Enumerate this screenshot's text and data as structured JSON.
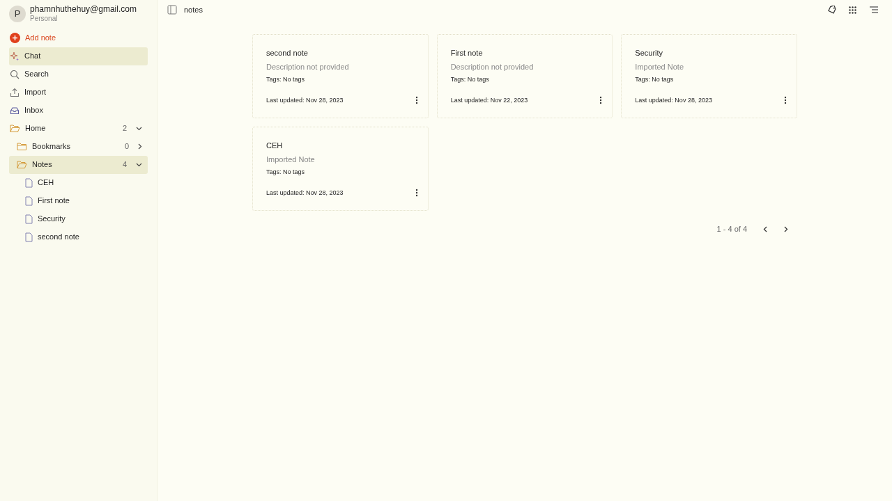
{
  "account": {
    "initial": "P",
    "email": "phamnhuthehuy@gmail.com",
    "workspace": "Personal"
  },
  "nav": [
    {
      "kind": "add",
      "label": "Add note",
      "selected": false
    },
    {
      "kind": "chat",
      "label": "Chat",
      "selected": true
    },
    {
      "kind": "search",
      "label": "Search",
      "selected": false
    },
    {
      "kind": "import",
      "label": "Import",
      "selected": false
    },
    {
      "kind": "inbox",
      "label": "Inbox",
      "selected": false
    }
  ],
  "tree": [
    {
      "kind": "folder",
      "label": "Home",
      "count": "2",
      "expanded": true,
      "selected": false,
      "children": [
        {
          "kind": "folder",
          "label": "Bookmarks",
          "count": "0",
          "expanded": false,
          "selected": false
        },
        {
          "kind": "folder",
          "label": "Notes",
          "count": "4",
          "expanded": true,
          "selected": true,
          "children": [
            {
              "kind": "note",
              "label": "CEH",
              "selected": false
            },
            {
              "kind": "note",
              "label": "First note",
              "selected": false
            },
            {
              "kind": "note",
              "label": "Security",
              "selected": false
            },
            {
              "kind": "note",
              "label": "second note",
              "selected": false
            }
          ]
        }
      ]
    }
  ],
  "header": {
    "breadcrumb": "notes"
  },
  "cards": [
    {
      "title": "second note",
      "description": "Description not provided",
      "tags": "Tags: No tags",
      "updated": "Last updated: Nov 28, 2023"
    },
    {
      "title": "First note",
      "description": "Description not provided",
      "tags": "Tags: No tags",
      "updated": "Last updated: Nov 22, 2023"
    },
    {
      "title": "Security",
      "description": "Imported Note",
      "tags": "Tags: No tags",
      "updated": "Last updated: Nov 28, 2023"
    },
    {
      "title": "CEH",
      "description": "Imported Note",
      "tags": "Tags: No tags",
      "updated": "Last updated: Nov 28, 2023"
    }
  ],
  "pagination": {
    "range": "1 - 4 of 4"
  }
}
